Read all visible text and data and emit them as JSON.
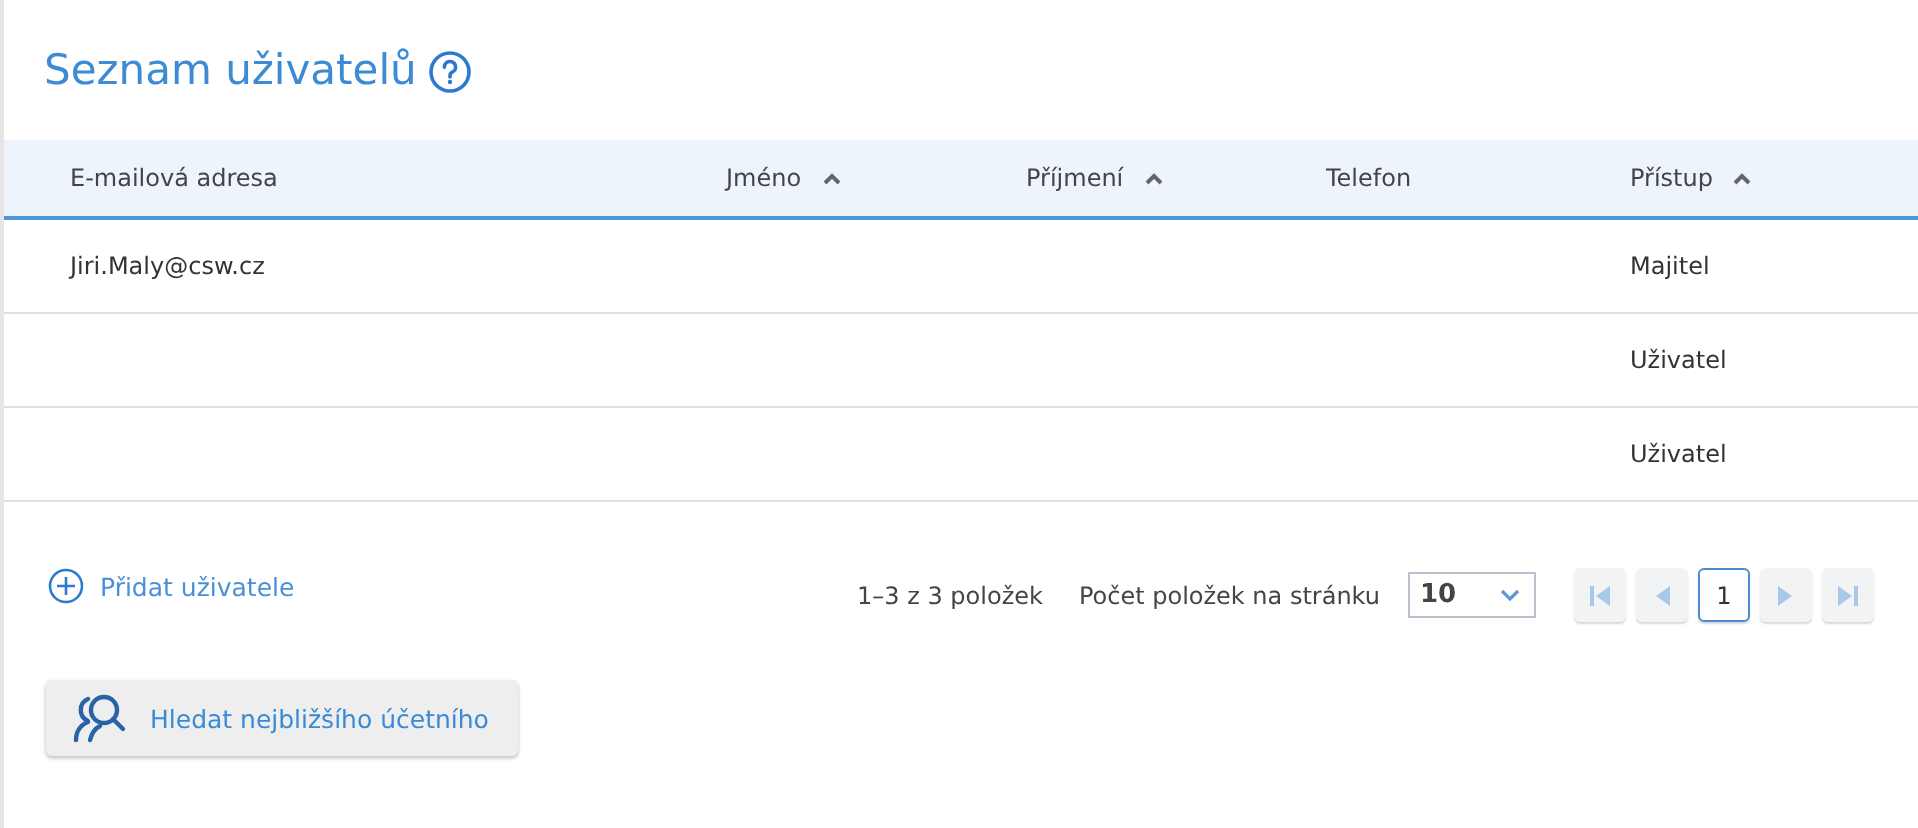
{
  "title": "Seznam uživatelů",
  "table": {
    "columns": [
      {
        "label": "E-mailová adresa",
        "sorted": false
      },
      {
        "label": "Jméno",
        "sorted": true
      },
      {
        "label": "Příjmení",
        "sorted": true
      },
      {
        "label": "Telefon",
        "sorted": false
      },
      {
        "label": "Přístup",
        "sorted": true
      }
    ],
    "rows": [
      [
        "Jiri.Maly@csw.cz",
        "",
        "",
        "",
        "Majitel"
      ],
      [
        "",
        "",
        "",
        "",
        "Uživatel"
      ],
      [
        "",
        "",
        "",
        "",
        "Uživatel"
      ]
    ]
  },
  "add_user": "Přidat uživatele",
  "pager": {
    "summary": "1–3 z 3 položek",
    "page_size_label": "Počet položek na stránku",
    "page_size": "10",
    "page": "1",
    "buttons": [
      {
        "kind": "first",
        "disabled": true
      },
      {
        "kind": "prev",
        "disabled": true
      },
      {
        "kind": "next",
        "disabled": true
      },
      {
        "kind": "last",
        "disabled": true
      }
    ]
  },
  "find_button": "Hledat nejbližšího účetního"
}
